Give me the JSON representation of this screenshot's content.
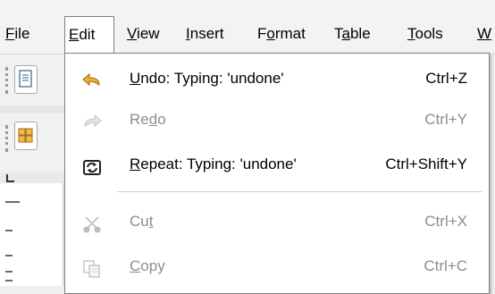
{
  "menubar": {
    "items": [
      {
        "pre": "",
        "mn": "F",
        "post": "ile"
      },
      {
        "pre": "",
        "mn": "E",
        "post": "dit"
      },
      {
        "pre": "",
        "mn": "V",
        "post": "iew"
      },
      {
        "pre": "",
        "mn": "I",
        "post": "nsert"
      },
      {
        "pre": "F",
        "mn": "o",
        "post": "rmat"
      },
      {
        "pre": "T",
        "mn": "a",
        "post": "ble"
      },
      {
        "pre": "",
        "mn": "T",
        "post": "ools"
      },
      {
        "pre": "",
        "mn": "W",
        "post": ""
      }
    ]
  },
  "edit_menu": {
    "items": [
      {
        "pre": "",
        "mn": "U",
        "post": "ndo: Typing: 'undone'",
        "shortcut": "Ctrl+Z",
        "enabled": true,
        "icon": "undo-icon"
      },
      {
        "pre": "Re",
        "mn": "d",
        "post": "o",
        "shortcut": "Ctrl+Y",
        "enabled": false,
        "icon": "redo-icon"
      },
      {
        "pre": "",
        "mn": "R",
        "post": "epeat: Typing: 'undone'",
        "shortcut": "Ctrl+Shift+Y",
        "enabled": true,
        "icon": "repeat-icon"
      },
      {
        "pre": "Cu",
        "mn": "t",
        "post": "",
        "shortcut": "Ctrl+X",
        "enabled": false,
        "icon": "cut-icon"
      },
      {
        "pre": "",
        "mn": "C",
        "post": "opy",
        "shortcut": "Ctrl+C",
        "enabled": false,
        "icon": "copy-icon"
      }
    ]
  },
  "colors": {
    "accent_undo": "#e0a020",
    "disabled_text": "#8d8d8d",
    "menu_border": "#7f7f7f"
  }
}
